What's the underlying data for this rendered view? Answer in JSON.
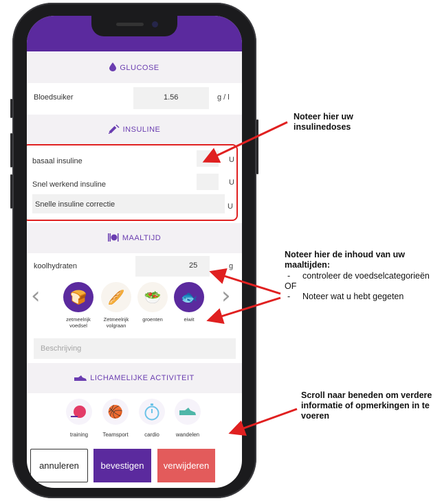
{
  "glucose": {
    "title": "GLUCOSE",
    "label": "Bloedsuiker",
    "value": "1.56",
    "unit": "g / l"
  },
  "insulin": {
    "title": "INSULINE",
    "rows": [
      {
        "label": "basaal insuline",
        "unit": "U"
      },
      {
        "label": "Snel werkend insuline",
        "unit": "U"
      },
      {
        "label": "Snelle insuline correctie",
        "unit": "U"
      }
    ]
  },
  "meal": {
    "title": "MAALTIJD",
    "carbs_label": "koolhydraten",
    "carbs_value": "25",
    "carbs_unit": "g",
    "categories": [
      {
        "label": "zetmeelrijk voedsel",
        "icon": "bread-icon",
        "selected": true
      },
      {
        "label": "Zetmeelrijk volgraan",
        "icon": "grain-icon",
        "selected": false
      },
      {
        "label": "groenten",
        "icon": "vegetables-icon",
        "selected": false
      },
      {
        "label": "eiwit",
        "icon": "protein-icon",
        "selected": true
      }
    ],
    "description_placeholder": "Beschrijving"
  },
  "activity": {
    "title": "LICHAMELIJKE ACTIVITEIT",
    "items": [
      {
        "label": "training",
        "icon": "training-icon"
      },
      {
        "label": "Teamsport",
        "icon": "teamsport-icon"
      },
      {
        "label": "cardio",
        "icon": "stopwatch-icon"
      },
      {
        "label": "wandelen",
        "icon": "shoe-icon"
      }
    ]
  },
  "buttons": {
    "cancel": "annuleren",
    "confirm": "bevestigen",
    "delete": "verwijderen"
  },
  "annotations": {
    "insulin_note": "Noteer hier uw insulinedoses",
    "meal_note_title": "Noteer hier de inhoud van uw maaltijden:",
    "meal_note_item1": "controleer de voedselcategorieën",
    "meal_note_or": "OF",
    "meal_note_item2": "Noteer wat u hebt gegeten",
    "scroll_note": "Scroll naar beneden om verdere informatie of opmerkingen in te voeren"
  },
  "colors": {
    "brand_purple": "#5b2a9e",
    "accent_purple": "#6a3db0",
    "delete_red": "#e35b5b",
    "annotation_red": "#e02020"
  }
}
